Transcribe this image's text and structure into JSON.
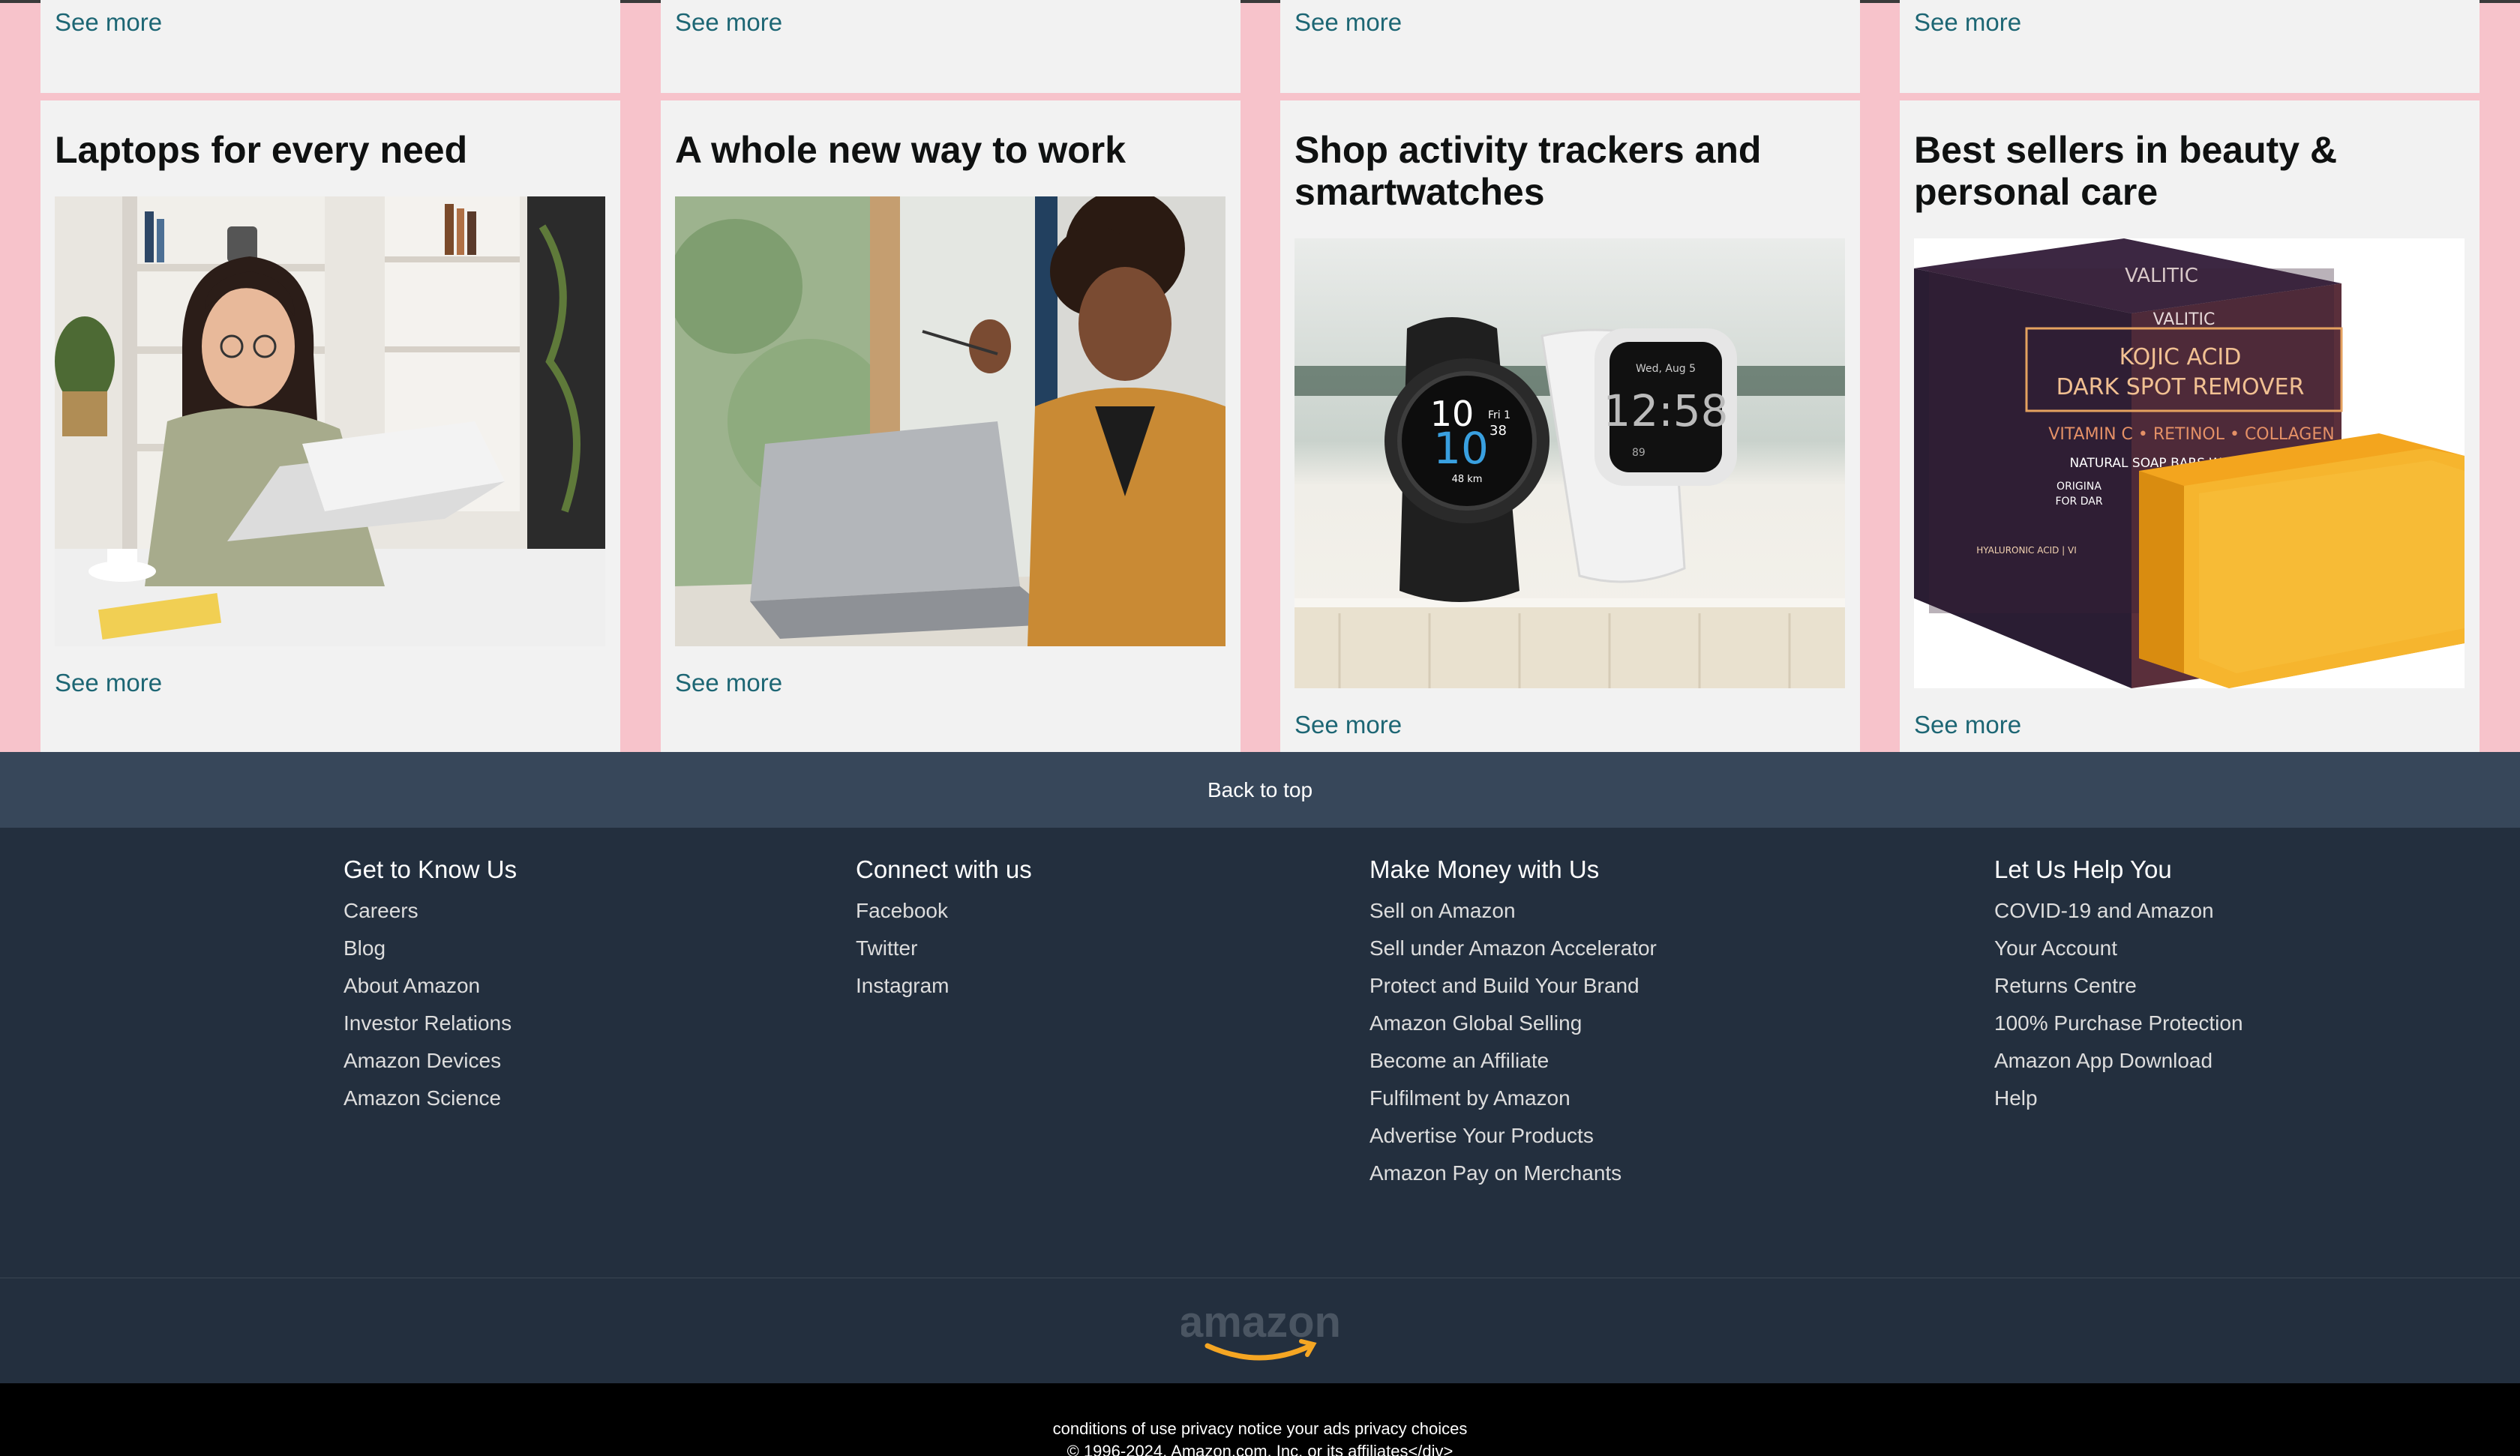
{
  "top_row": {
    "see_more": [
      "See more",
      "See more",
      "See more",
      "See more"
    ]
  },
  "cards": [
    {
      "title": "Laptops for every need",
      "see_more": "See more",
      "image": "woman-laptop-photo"
    },
    {
      "title": "A whole new way to work",
      "see_more": "See more",
      "image": "woman-working-laptop-photo"
    },
    {
      "title": "Shop activity trackers and smartwatches",
      "see_more": "See more",
      "image": "smartwatches-photo"
    },
    {
      "title": "Best sellers in beauty & personal care",
      "see_more": "See more",
      "image": "soap-product-photo"
    }
  ],
  "watch": {
    "black_top": "10",
    "black_date": "Fri 1",
    "black_big": "10",
    "black_small": "38",
    "black_km": "48 km",
    "white_date": "Wed, Aug 5",
    "white_time": "12:58",
    "white_hr": "89"
  },
  "product": {
    "brand_top": "VALITIC",
    "brand": "VALITIC",
    "line1": "KOJIC ACID",
    "line2": "DARK SPOT REMOVER",
    "line3": "VITAMIN C • RETINOL • COLLAGEN",
    "line4": "NATURAL SOAP BARS WITH TURMERIC",
    "line5": "ORIGINA",
    "line6": "FOR DAR",
    "line7": "HYALURONIC ACID | VI"
  },
  "back_to_top": "Back to top",
  "footer": {
    "columns": [
      {
        "heading": "Get to Know Us",
        "links": [
          "Careers",
          "Blog",
          "About Amazon",
          "Investor Relations",
          "Amazon Devices",
          "Amazon Science"
        ]
      },
      {
        "heading": "Connect with us",
        "links": [
          "Facebook",
          "Twitter",
          "Instagram"
        ]
      },
      {
        "heading": "Make Money with Us",
        "links": [
          "Sell on Amazon",
          "Sell under Amazon Accelerator",
          "Protect and Build Your Brand",
          "Amazon Global Selling",
          "Become an Affiliate",
          "Fulfilment by Amazon",
          "Advertise Your Products",
          "Amazon Pay on Merchants"
        ]
      },
      {
        "heading": "Let Us Help You",
        "links": [
          "COVID-19 and Amazon",
          "Your Account",
          "Returns Centre",
          "100% Purchase Protection",
          "Amazon App Download",
          "Help"
        ]
      }
    ],
    "logo_text": "amazon",
    "bottom_links": "conditions of use privacy notice your ads privacy choices",
    "copyright": "© 1996-2024, Amazon.com, Inc. or its affiliates</div>"
  },
  "colors": {
    "page_bg": "#f7c3cb",
    "card_bg": "#f2f2f2",
    "link": "#1d6674",
    "back_to_top_bg": "#37475a",
    "footer_bg": "#232f3e",
    "accent_orange": "#f5a623"
  }
}
